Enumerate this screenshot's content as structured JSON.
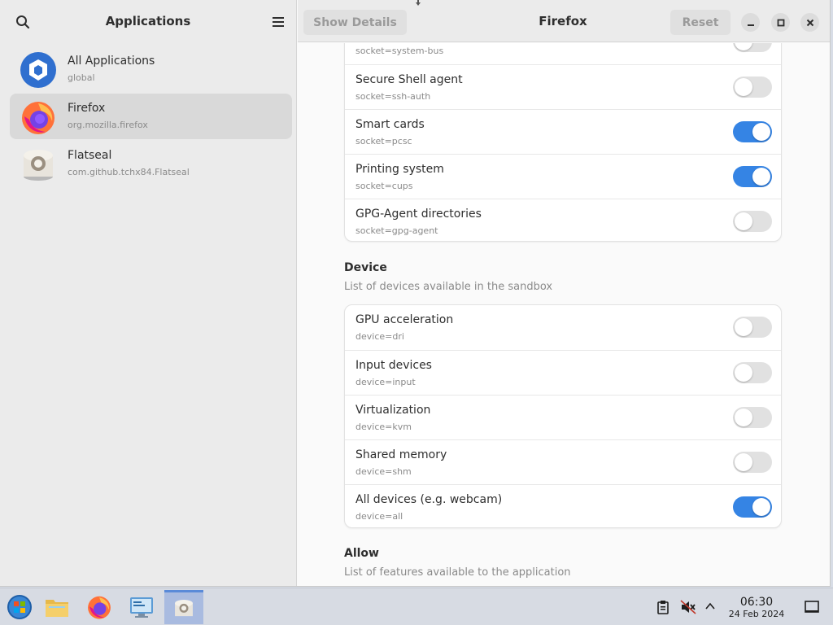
{
  "sidebar": {
    "title": "Applications",
    "search_icon": "search-icon",
    "menu_icon": "hamburger-menu-icon",
    "apps": [
      {
        "name": "All Applications",
        "id": "global",
        "icon": "flatpak-box-icon",
        "selected": false
      },
      {
        "name": "Firefox",
        "id": "org.mozilla.firefox",
        "icon": "firefox-icon",
        "selected": true
      },
      {
        "name": "Flatseal",
        "id": "com.github.tchx84.Flatseal",
        "icon": "flatseal-icon",
        "selected": false
      }
    ]
  },
  "header": {
    "show_details": "Show Details",
    "title": "Firefox",
    "reset": "Reset"
  },
  "sockets": {
    "rows": [
      {
        "title": "",
        "sub": "socket=system-bus",
        "on": false
      },
      {
        "title": "Secure Shell agent",
        "sub": "socket=ssh-auth",
        "on": false
      },
      {
        "title": "Smart cards",
        "sub": "socket=pcsc",
        "on": true
      },
      {
        "title": "Printing system",
        "sub": "socket=cups",
        "on": true
      },
      {
        "title": "GPG-Agent directories",
        "sub": "socket=gpg-agent",
        "on": false
      }
    ]
  },
  "device": {
    "title": "Device",
    "subtitle": "List of devices available in the sandbox",
    "rows": [
      {
        "title": "GPU acceleration",
        "sub": "device=dri",
        "on": false
      },
      {
        "title": "Input devices",
        "sub": "device=input",
        "on": false
      },
      {
        "title": "Virtualization",
        "sub": "device=kvm",
        "on": false
      },
      {
        "title": "Shared memory",
        "sub": "device=shm",
        "on": false
      },
      {
        "title": "All devices (e.g. webcam)",
        "sub": "device=all",
        "on": true
      }
    ]
  },
  "allow": {
    "title": "Allow",
    "subtitle": "List of features available to the application"
  },
  "colors": {
    "accent": "#3584e4",
    "toggle_off": "#e1e1e1"
  },
  "taskbar": {
    "items": [
      "start-orb-icon",
      "file-manager-icon",
      "firefox-icon",
      "control-panel-icon",
      "flatseal-icon"
    ],
    "tray": [
      "clipboard-icon",
      "volume-muted-icon",
      "chevron-up-icon",
      "show-desktop-icon"
    ],
    "time": "06:30",
    "date": "24 Feb 2024"
  }
}
